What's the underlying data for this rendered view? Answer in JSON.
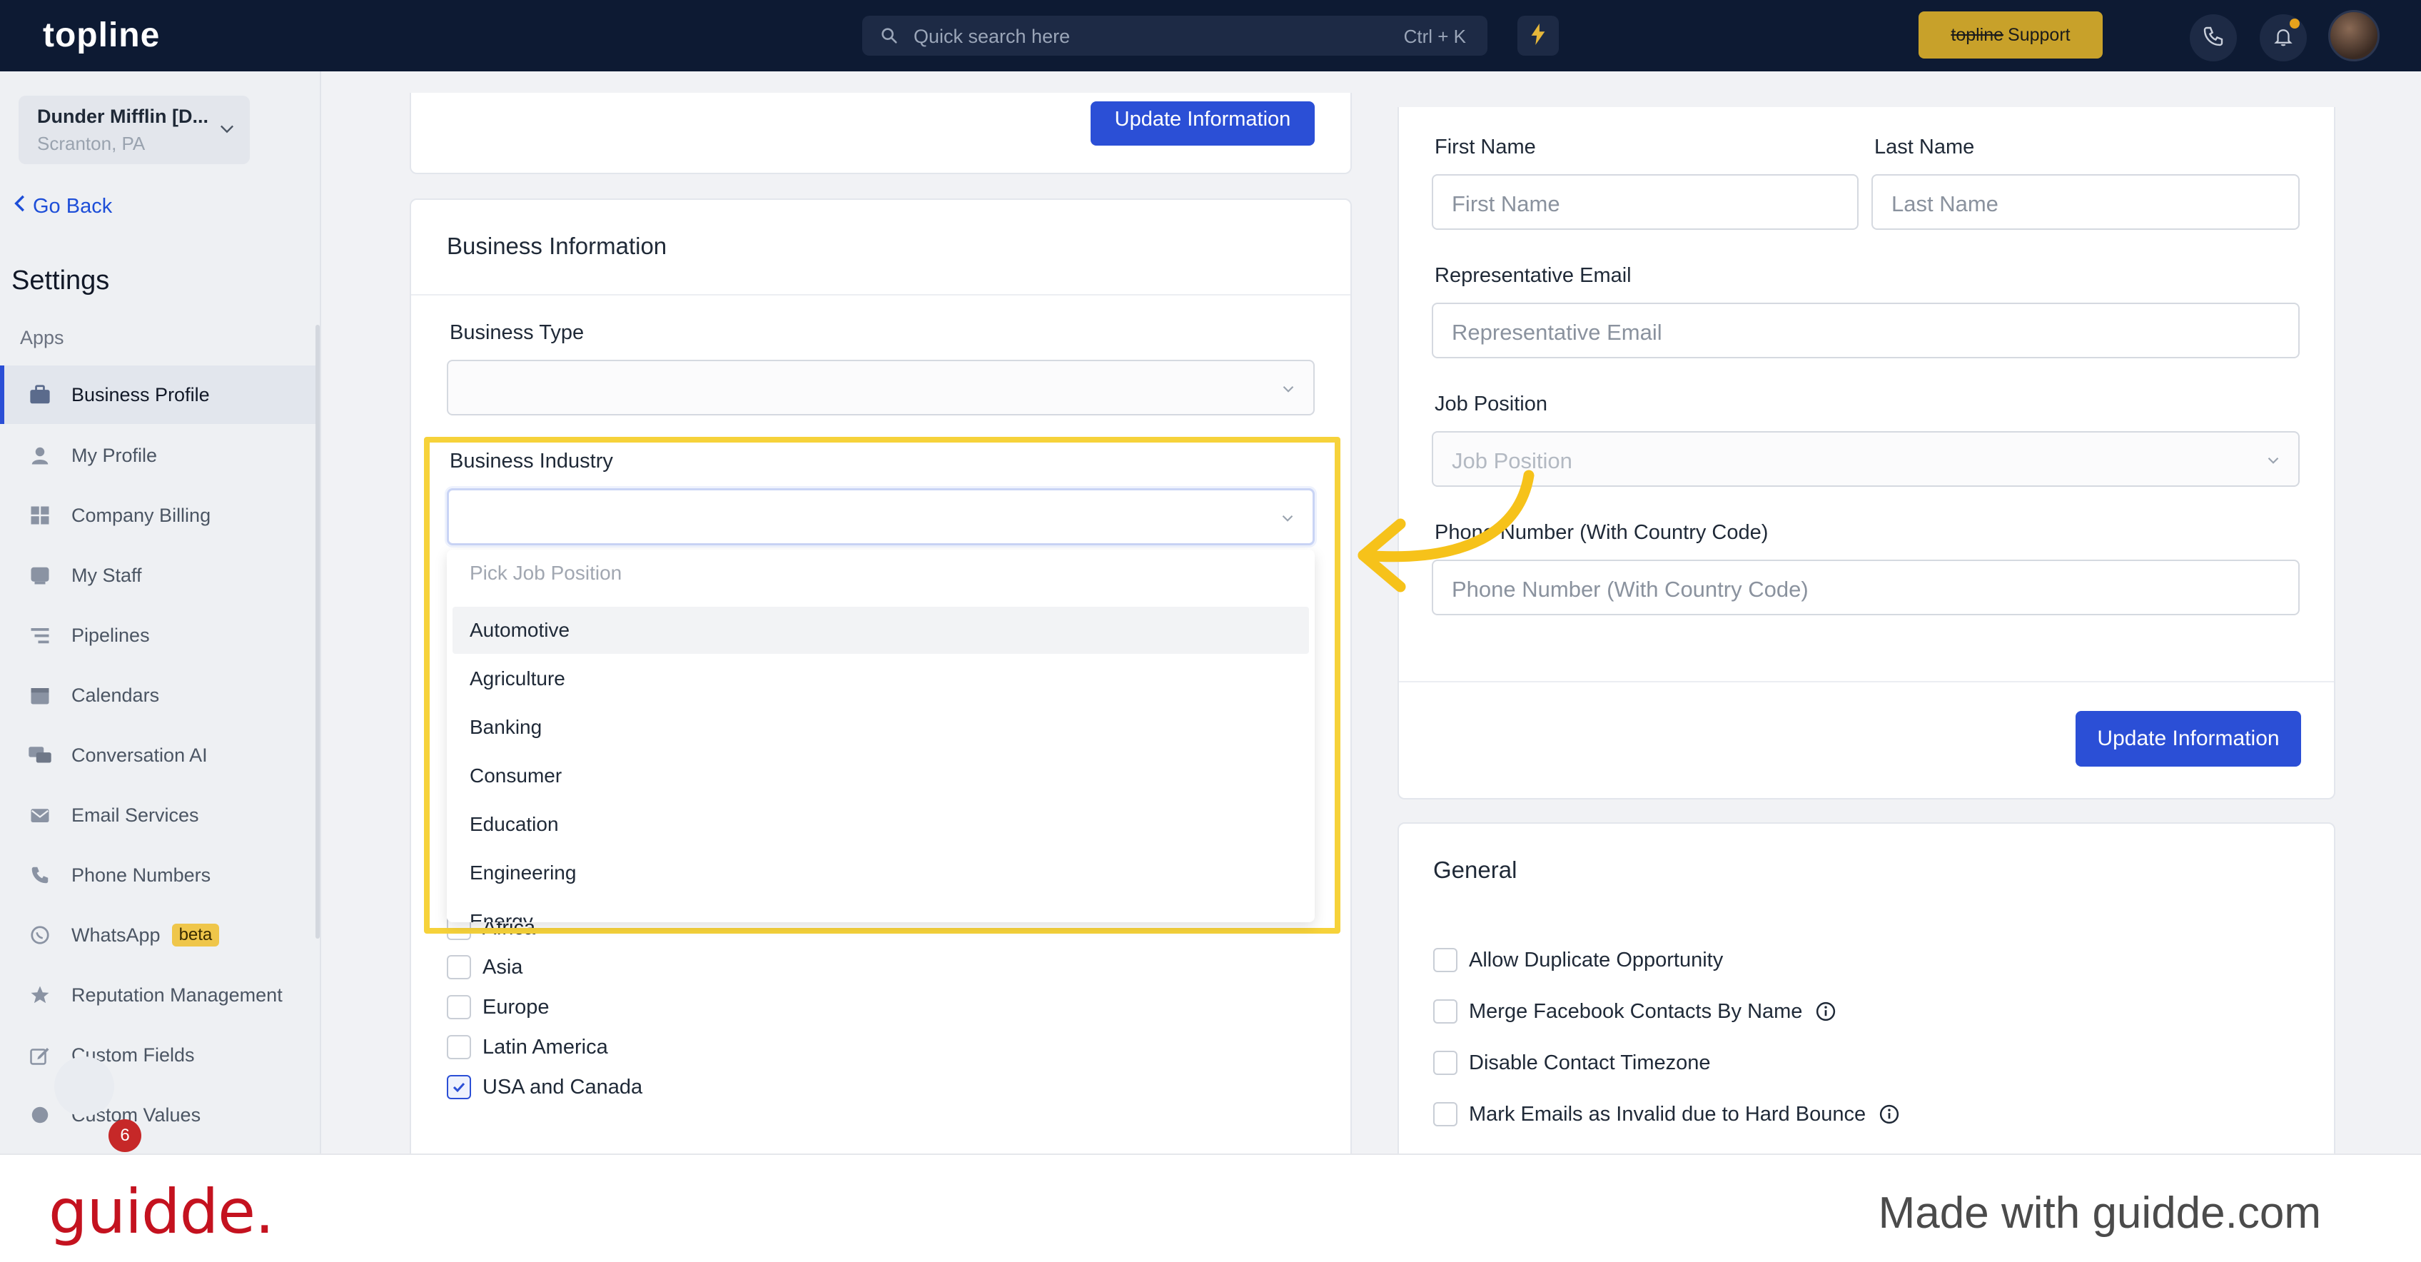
{
  "app": {
    "logo": "topline"
  },
  "search": {
    "placeholder": "Quick search here",
    "shortcut": "Ctrl + K"
  },
  "header": {
    "support_brand": "topline",
    "support_label": "Support"
  },
  "location": {
    "name": "Dunder Mifflin [D...",
    "city": "Scranton, PA"
  },
  "sidebar": {
    "go_back": "Go Back",
    "title": "Settings",
    "section": "Apps",
    "items": [
      {
        "label": "Business Profile",
        "icon": "briefcase-icon"
      },
      {
        "label": "My Profile",
        "icon": "user-icon"
      },
      {
        "label": "Company Billing",
        "icon": "grid-icon"
      },
      {
        "label": "My Staff",
        "icon": "staff-icon"
      },
      {
        "label": "Pipelines",
        "icon": "filter-icon"
      },
      {
        "label": "Calendars",
        "icon": "calendar-icon"
      },
      {
        "label": "Conversation AI",
        "icon": "chat-icon"
      },
      {
        "label": "Email Services",
        "icon": "mail-icon"
      },
      {
        "label": "Phone Numbers",
        "icon": "phone-icon"
      },
      {
        "label": "WhatsApp",
        "icon": "whatsapp-icon",
        "badge": "beta"
      },
      {
        "label": "Reputation Management",
        "icon": "star-icon"
      },
      {
        "label": "Custom Fields",
        "icon": "edit-icon"
      },
      {
        "label": "Custom Values",
        "icon": "values-icon"
      }
    ],
    "chat_count": "6"
  },
  "business": {
    "top_button": "Update Information",
    "title": "Business Information",
    "type_label": "Business Type",
    "industry_label": "Business Industry",
    "dropdown": {
      "placeholder": "Pick Job Position",
      "options": [
        "Automotive",
        "Agriculture",
        "Banking",
        "Consumer",
        "Education",
        "Engineering",
        "Energy"
      ]
    },
    "regions": [
      {
        "label": "Africa",
        "checked": false
      },
      {
        "label": "Asia",
        "checked": false
      },
      {
        "label": "Europe",
        "checked": false
      },
      {
        "label": "Latin America",
        "checked": false
      },
      {
        "label": "USA and Canada",
        "checked": true
      }
    ]
  },
  "representative": {
    "first_name_label": "First Name",
    "first_name_placeholder": "First Name",
    "last_name_label": "Last Name",
    "last_name_placeholder": "Last Name",
    "email_label": "Representative Email",
    "email_placeholder": "Representative Email",
    "job_label": "Job Position",
    "job_placeholder": "Job Position",
    "phone_label": "Phone Number (With Country Code)",
    "phone_placeholder": "Phone Number (With Country Code)",
    "button": "Update Information"
  },
  "general": {
    "title": "General",
    "options": [
      {
        "label": "Allow Duplicate Opportunity",
        "info": false
      },
      {
        "label": "Merge Facebook Contacts By Name",
        "info": true
      },
      {
        "label": "Disable Contact Timezone",
        "info": false
      },
      {
        "label": "Mark Emails as Invalid due to Hard Bounce",
        "info": true
      }
    ]
  },
  "footer": {
    "logo": "guidde.",
    "tagline": "Made with guidde.com"
  },
  "colors": {
    "accent": "#2b4fd6",
    "highlight": "#f6d23a",
    "topbar": "#0d1a33",
    "support": "#c8a12a",
    "brand_red": "#c4121f"
  }
}
